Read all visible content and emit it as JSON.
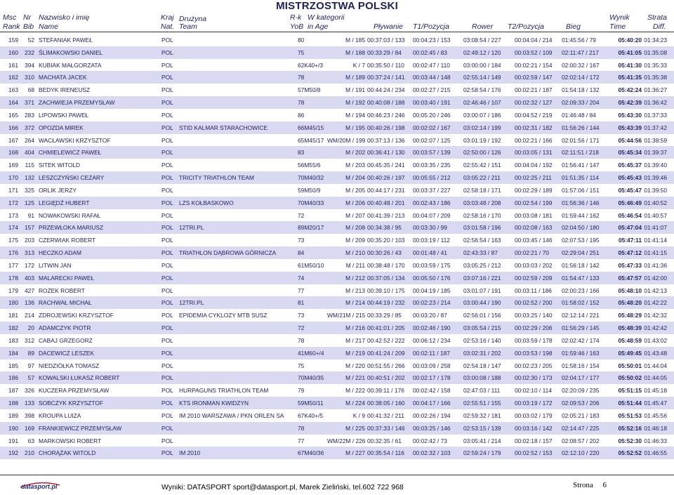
{
  "title": "MISTRZOSTWA POLSKI",
  "headers": {
    "msc": "Msc",
    "rank": "Rank",
    "nr": "Nr",
    "bib": "Bib",
    "name_pl": "Nazwisko i imię",
    "name_en": "Name",
    "kraj": "Kraj",
    "nat": "Nat.",
    "team_pl": "Drużyna",
    "team_en": "Team",
    "rk": "R-k",
    "yob": "YoB",
    "kat_pl": "W kategorii",
    "kat_en": "in Age",
    "swim": "Pływanie",
    "t1": "T1/Pozycja",
    "bike": "Rower",
    "t2": "T2/Pozycja",
    "run": "Bieg",
    "result_pl": "Wynik",
    "result_en": "Time",
    "diff_pl": "Strata",
    "diff_en": "Diff."
  },
  "rows": [
    [
      "159",
      "52",
      "STEFANIAK PAWEŁ",
      "POL",
      "",
      "80",
      "M / 185",
      "00:37:03 / 133",
      "00:04:23 / 153",
      "03:08:54 / 227",
      "00:04:04 / 214",
      "01:45:56 / 79",
      "05:40:20",
      "01:34:23"
    ],
    [
      "160",
      "232",
      "ŚLIMAKOWSKI DANIEL",
      "POL",
      "",
      "75",
      "M / 188",
      "00:33:29 / 84",
      "00:02:45 / 83",
      "02:49:12 / 120",
      "00:03:52 / 109",
      "02:11:47 / 217",
      "05:41:05",
      "01:35:08"
    ],
    [
      "161",
      "394",
      "KUBIAK MAŁGORZATA",
      "POL",
      "",
      "62K40+/3",
      "K / 7",
      "00:35:50 / 110",
      "00:02:47 / 110",
      "03:00:00 / 184",
      "00:02:21 / 154",
      "02:00:32 / 167",
      "05:41:30",
      "01:35:33"
    ],
    [
      "162",
      "310",
      "MACHATA JACEK",
      "POL",
      "",
      "78",
      "M / 189",
      "00:37:24 / 141",
      "00:03:44 / 148",
      "02:55:14 / 149",
      "00:02:59 / 147",
      "02:02:14 / 172",
      "05:41:35",
      "01:35:38"
    ],
    [
      "163",
      "68",
      "BEDYK IRENEUSZ",
      "POL",
      "",
      "57M50/8",
      "M / 191",
      "00:44:24 / 234",
      "00:02:27 / 215",
      "02:58:54 / 176",
      "00:02:21 / 187",
      "01:54:18 / 132",
      "05:42:24",
      "01:36:27"
    ],
    [
      "164",
      "371",
      "ZACHWIEJA PRZEMYSŁAW",
      "POL",
      "",
      "78",
      "M / 192",
      "00:40:08 / 188",
      "00:03:40 / 191",
      "02:46:46 / 107",
      "00:02:32 / 127",
      "02:09:33 / 204",
      "05:42:39",
      "01:36:42"
    ],
    [
      "165",
      "283",
      "LIPOWSKI PAWEŁ",
      "POL",
      "",
      "86",
      "M / 194",
      "00:46:23 / 246",
      "00:05:20 / 246",
      "03:00:07 / 186",
      "00:04:52 / 219",
      "01:46:48 / 84",
      "05:43:30",
      "01:37:33"
    ],
    [
      "166",
      "372",
      "OPOZDA MIREK",
      "POL",
      "STID KALMAR STARACHOWICE",
      "66M45/15",
      "M / 195",
      "00:40:26 / 198",
      "00:02:02 / 167",
      "03:02:14 / 199",
      "00:02:31 / 182",
      "01:56:26 / 144",
      "05:43:39",
      "01:37:42"
    ],
    [
      "167",
      "264",
      "WACŁAWSKI KRZYSZTOF",
      "POL",
      "",
      "65M45/17",
      "WM/20M / 199",
      "00:37:13 / 136",
      "00:02:07 / 125",
      "03:01:19 / 192",
      "00:02:21 / 166",
      "02:01:56 / 171",
      "05:44:56",
      "01:38:59"
    ],
    [
      "168",
      "404",
      "CHMIELEWICZ PAWEŁ",
      "POL",
      "",
      "83",
      "M / 202",
      "00:36:41 / 130",
      "00:03:57 / 139",
      "02:50:00 / 126",
      "00:03:05 / 131",
      "02:11:51 / 218",
      "05:45:34",
      "01:39:37"
    ],
    [
      "169",
      "115",
      "SITEK WITOLD",
      "POL",
      "",
      "56M55/6",
      "M / 203",
      "00:45:35 / 241",
      "00:03:35 / 235",
      "02:55:42 / 151",
      "00:04:04 / 192",
      "01:56:41 / 147",
      "05:45:37",
      "01:39:40"
    ],
    [
      "170",
      "132",
      "LESZCZYŃSKI CEZARY",
      "POL",
      "TRICITY TRIATHLON TEAM",
      "70M40/32",
      "M / 204",
      "00:40:26 / 197",
      "00:05:55 / 212",
      "03:05:22 / 211",
      "00:02:25 / 211",
      "01:51:35 / 114",
      "05:45:43",
      "01:39:46"
    ],
    [
      "171",
      "325",
      "ORLIK JERZY",
      "POL",
      "",
      "59M50/9",
      "M / 205",
      "00:44:17 / 231",
      "00:03:37 / 227",
      "02:58:18 / 171",
      "00:02:29 / 189",
      "01:57:06 / 151",
      "05:45:47",
      "01:39:50"
    ],
    [
      "172",
      "125",
      "LEGIĘDŹ HUBERT",
      "POL",
      "LZS KOŁBASKOWO",
      "70M40/33",
      "M / 206",
      "00:40:48 / 201",
      "00:02:43 / 186",
      "03:03:48 / 208",
      "00:02:54 / 199",
      "01:56:36 / 146",
      "05:46:49",
      "01:40:52"
    ],
    [
      "173",
      "91",
      "NOWAKOWSKI RAFAŁ",
      "POL",
      "",
      "72",
      "M / 207",
      "00:41:39 / 213",
      "00:04:07 / 209",
      "02:58:16 / 170",
      "00:03:08 / 181",
      "01:59:44 / 162",
      "05:46:54",
      "01:40:57"
    ],
    [
      "174",
      "157",
      "PRZEWŁOKA MARIUSZ",
      "POL",
      "12TRI.PL",
      "89M20/17",
      "M / 208",
      "00:34:38 / 95",
      "00:03:30 / 99",
      "03:01:58 / 196",
      "00:02:08 / 163",
      "02:04:50 / 180",
      "05:47:04",
      "01:41:07"
    ],
    [
      "175",
      "203",
      "CZERWIAK ROBERT",
      "POL",
      "",
      "73",
      "M / 209",
      "00:35:20 / 103",
      "00:03:19 / 112",
      "02:56:54 / 163",
      "00:03:45 / 146",
      "02:07:53 / 195",
      "05:47:11",
      "01:41:14"
    ],
    [
      "176",
      "313",
      "HECZKO ADAM",
      "POL",
      "TRIATHLON DĄBROWA GÓRNICZA",
      "84",
      "M / 210",
      "00:30:26 / 43",
      "00:01:48 / 41",
      "02:43:33 / 87",
      "00:02:21 / 70",
      "02:29:04 / 251",
      "05:47:12",
      "01:41:15"
    ],
    [
      "177",
      "172",
      "LITWIN JAN",
      "POL",
      "",
      "61M50/10",
      "M / 211",
      "00:38:48 / 170",
      "00:03:59 / 175",
      "03:05:25 / 212",
      "00:03:03 / 202",
      "01:56:18 / 142",
      "05:47:33",
      "01:41:36"
    ],
    [
      "178",
      "403",
      "MALARECKI PAWEŁ",
      "POL",
      "",
      "74",
      "M / 212",
      "00:37:05 / 134",
      "00:05:50 / 176",
      "03:07:16 / 221",
      "00:02:59 / 209",
      "01:54:47 / 133",
      "05:47:57",
      "01:42:00"
    ],
    [
      "179",
      "427",
      "ROŻEK ROBERT",
      "POL",
      "",
      "77",
      "M / 213",
      "00:39:10 / 175",
      "00:04:19 / 185",
      "03:01:07 / 191",
      "00:03:11 / 186",
      "02:00:23 / 166",
      "05:48:10",
      "01:42:13"
    ],
    [
      "180",
      "136",
      "RACHWAŁ MICHAŁ",
      "POL",
      "12TRI.PL",
      "81",
      "M / 214",
      "00:44:19 / 232",
      "00:02:23 / 214",
      "03:00:44 / 190",
      "00:02:52 / 200",
      "01:58:02 / 152",
      "05:48:20",
      "01:42:22"
    ],
    [
      "181",
      "214",
      "ZDROJEWSKI KRZYSZTOF",
      "POL",
      "EPIDEMIA CYKLOZY MTB SUSZ",
      "73",
      "WM/21M / 215",
      "00:33:29 / 85",
      "00:03:20 / 87",
      "02:56:01 / 156",
      "00:03:25 / 140",
      "02:12:14 / 221",
      "05:48:29",
      "01:42:32"
    ],
    [
      "182",
      "20",
      "ADAMCZYK PIOTR",
      "POL",
      "",
      "72",
      "M / 216",
      "00:41:01 / 205",
      "00:02:46 / 190",
      "03:05:54 / 215",
      "00:02:29 / 206",
      "01:56:29 / 145",
      "05:48:39",
      "01:42:42"
    ],
    [
      "183",
      "312",
      "CABAJ GRZEGORZ",
      "POL",
      "",
      "78",
      "M / 217",
      "00:42:52 / 222",
      "00:06:12 / 234",
      "02:53:16 / 140",
      "00:03:59 / 178",
      "02:02:42 / 174",
      "05:48:59",
      "01:43:02"
    ],
    [
      "184",
      "89",
      "DACEWICZ LESZEK",
      "POL",
      "",
      "41M60+/4",
      "M / 219",
      "00:41:24 / 209",
      "00:02:11 / 187",
      "03:02:31 / 202",
      "00:03:53 / 198",
      "01:59:46 / 163",
      "05:49:45",
      "01:43:48"
    ],
    [
      "185",
      "97",
      "NIEDZIÓŁKA TOMASZ",
      "POL",
      "",
      "75",
      "M / 220",
      "00:51:55 / 266",
      "00:03:09 / 258",
      "02:54:18 / 147",
      "00:02:23 / 205",
      "01:58:16 / 154",
      "05:50:01",
      "01:44:04"
    ],
    [
      "186",
      "57",
      "KOWALSKI ŁUKASZ ROBERT",
      "POL",
      "",
      "70M40/35",
      "M / 221",
      "00:40:51 / 202",
      "00:02:17 / 178",
      "03:00:08 / 188",
      "00:02:30 / 173",
      "02:04:17 / 177",
      "05:50:02",
      "01:44:05"
    ],
    [
      "187",
      "326",
      "KUCZERA PRZEMYSŁAW",
      "POL",
      "HURPAGUNS TRIATHLON TEAM",
      "79",
      "M / 222",
      "00:39:11 / 176",
      "00:02:42 / 158",
      "02:47:03 / 111",
      "00:02:10 / 114",
      "02:20:09 / 235",
      "05:51:15",
      "01:45:18"
    ],
    [
      "188",
      "133",
      "SOBCZYK KRZYSZTOF",
      "POL",
      "KTS IRONMAN KWIDZYN",
      "59M50/11",
      "M / 224",
      "00:38:05 / 160",
      "00:04:17 / 166",
      "02:55:51 / 155",
      "00:03:19 / 172",
      "02:09:53 / 206",
      "05:51:44",
      "01:45:47"
    ],
    [
      "189",
      "398",
      "KROUPA LUIZA",
      "POL",
      "IM 2010 WARSZAWA / PKN ORLEN SA",
      "67K40+/5",
      "K / 9",
      "00:41:32 / 211",
      "00:02:26 / 194",
      "02:59:32 / 181",
      "00:03:02 / 179",
      "02:05:21 / 183",
      "05:51:53",
      "01:45:56"
    ],
    [
      "190",
      "169",
      "FRANKIEWICZ PRZEMYSŁAW",
      "POL",
      "",
      "78",
      "M / 225",
      "00:37:33 / 146",
      "00:03:25 / 146",
      "02:53:15 / 139",
      "00:03:16 / 142",
      "02:14:47 / 225",
      "05:52:16",
      "01:46:18"
    ],
    [
      "191",
      "63",
      "MARKOWSKI ROBERT",
      "POL",
      "",
      "77",
      "WM/22M / 226",
      "00:32:35 / 61",
      "00:02:42 / 73",
      "03:05:41 / 214",
      "00:02:18 / 157",
      "02:08:57 / 202",
      "05:52:30",
      "01:46:33"
    ],
    [
      "192",
      "210",
      "CHORĄŻAK WITOLD",
      "POL",
      "IM 2010",
      "67M40/36",
      "M / 227",
      "00:35:54 / 116",
      "00:02:32 / 103",
      "02:59:24 / 179",
      "00:02:52 / 153",
      "02:12:10 / 220",
      "05:52:52",
      "01:46:55"
    ]
  ],
  "footer": {
    "logo_text": "datasport.pl",
    "text": "Wyniki: DATASPORT sport@datasport.pl, Marek Zieliński, tel.602 722 968",
    "page_label": "Strona",
    "page_number": "6"
  },
  "colors": {
    "text": "#1f1f60",
    "shade": "#d9d9f2"
  }
}
